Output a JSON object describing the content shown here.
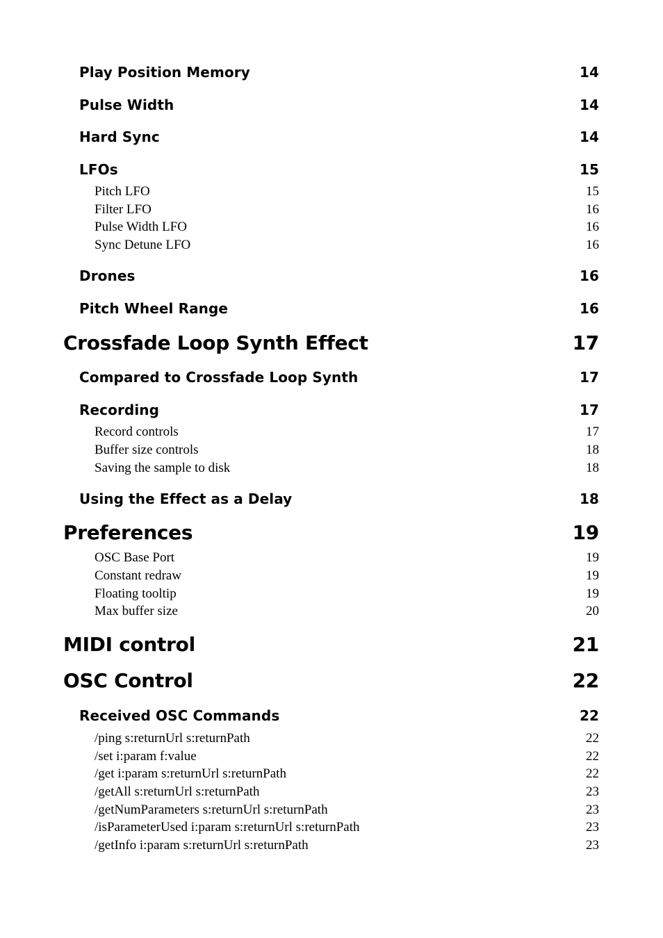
{
  "toc": {
    "entries": [
      {
        "level": 1,
        "title": "Play Position Memory",
        "page": "14"
      },
      {
        "level": 1,
        "title": "Pulse Width",
        "page": "14"
      },
      {
        "level": 1,
        "title": "Hard Sync",
        "page": "14"
      },
      {
        "level": 1,
        "title": "LFOs",
        "page": "15"
      },
      {
        "level": 2,
        "title": "Pitch LFO",
        "page": "15"
      },
      {
        "level": 2,
        "title": "Filter LFO",
        "page": "16"
      },
      {
        "level": 2,
        "title": "Pulse Width LFO",
        "page": "16"
      },
      {
        "level": 2,
        "title": "Sync Detune LFO",
        "page": "16"
      },
      {
        "level": 1,
        "title": "Drones",
        "page": "16"
      },
      {
        "level": 1,
        "title": "Pitch Wheel Range",
        "page": "16"
      },
      {
        "level": 0,
        "title": "Crossfade Loop Synth Effect",
        "page": "17"
      },
      {
        "level": 1,
        "title": "Compared to Crossfade Loop Synth",
        "page": "17"
      },
      {
        "level": 1,
        "title": "Recording",
        "page": "17"
      },
      {
        "level": 2,
        "title": "Record controls",
        "page": "17"
      },
      {
        "level": 2,
        "title": "Buffer size controls",
        "page": "18"
      },
      {
        "level": 2,
        "title": "Saving the sample to disk",
        "page": "18"
      },
      {
        "level": 1,
        "title": "Using the Effect as a Delay",
        "page": "18"
      },
      {
        "level": 0,
        "title": "Preferences",
        "page": "19"
      },
      {
        "level": 2,
        "title": "OSC Base Port",
        "page": "19"
      },
      {
        "level": 2,
        "title": "Constant redraw",
        "page": "19"
      },
      {
        "level": 2,
        "title": "Floating tooltip",
        "page": "19"
      },
      {
        "level": 2,
        "title": "Max buffer size",
        "page": "20"
      },
      {
        "level": 0,
        "title": "MIDI control",
        "page": "21"
      },
      {
        "level": 0,
        "title": "OSC Control",
        "page": "22"
      },
      {
        "level": 1,
        "title": "Received OSC Commands",
        "page": "22"
      },
      {
        "level": 2,
        "title": "/ping s:returnUrl s:returnPath",
        "page": "22"
      },
      {
        "level": 2,
        "title": "/set i:param f:value",
        "page": "22"
      },
      {
        "level": 2,
        "title": "/get i:param s:returnUrl s:returnPath",
        "page": "22"
      },
      {
        "level": 2,
        "title": "/getAll s:returnUrl s:returnPath",
        "page": "23"
      },
      {
        "level": 2,
        "title": "/getNumParameters s:returnUrl s:returnPath",
        "page": "23"
      },
      {
        "level": 2,
        "title": "/isParameterUsed i:param s:returnUrl s:returnPath",
        "page": "23"
      },
      {
        "level": 2,
        "title": "/getInfo i:param s:returnUrl s:returnPath",
        "page": "23"
      }
    ]
  }
}
